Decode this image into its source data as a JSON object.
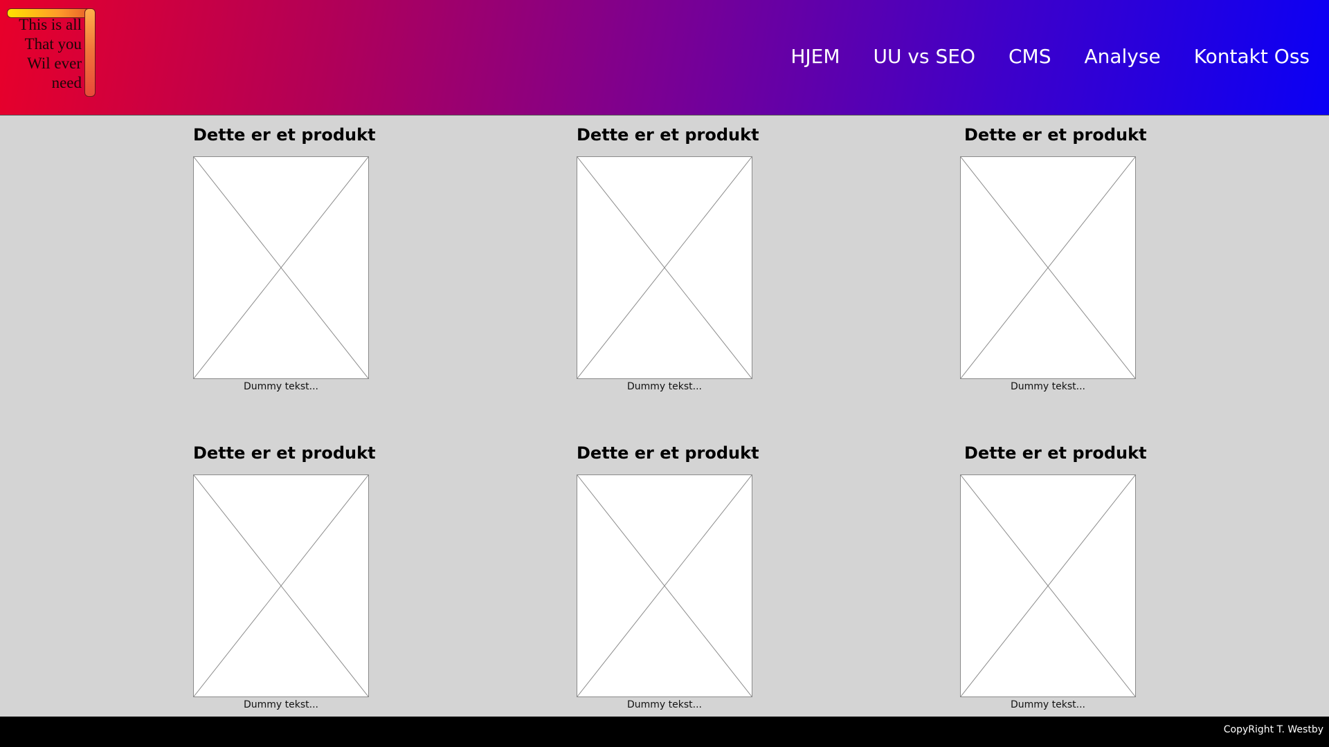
{
  "header": {
    "logo_lines": [
      "This is all",
      "That you",
      "Wil ever",
      "need"
    ],
    "nav": [
      "HJEM",
      "UU vs SEO",
      "CMS",
      "Analyse",
      "Kontakt Oss"
    ]
  },
  "products": [
    {
      "title": "Dette er et produkt",
      "image": "placeholder-image-icon",
      "caption": "Dummy tekst..."
    },
    {
      "title": "Dette er et produkt",
      "image": "placeholder-image-icon",
      "caption": "Dummy tekst..."
    },
    {
      "title": "Dette er et produkt",
      "image": "placeholder-image-icon",
      "caption": "Dummy tekst..."
    },
    {
      "title": "Dette er et produkt",
      "image": "placeholder-image-icon",
      "caption": "Dummy tekst..."
    },
    {
      "title": "Dette er et produkt",
      "image": "placeholder-image-icon",
      "caption": "Dummy tekst..."
    },
    {
      "title": "Dette er et produkt",
      "image": "placeholder-image-icon",
      "caption": "Dummy tekst..."
    }
  ],
  "footer": {
    "copyright": "CopyRight T. Westby"
  },
  "colors": {
    "header_gradient_start": "#e8002a",
    "header_gradient_end": "#0a00f5",
    "page_background": "#d4d4d4",
    "footer_background": "#000000"
  }
}
